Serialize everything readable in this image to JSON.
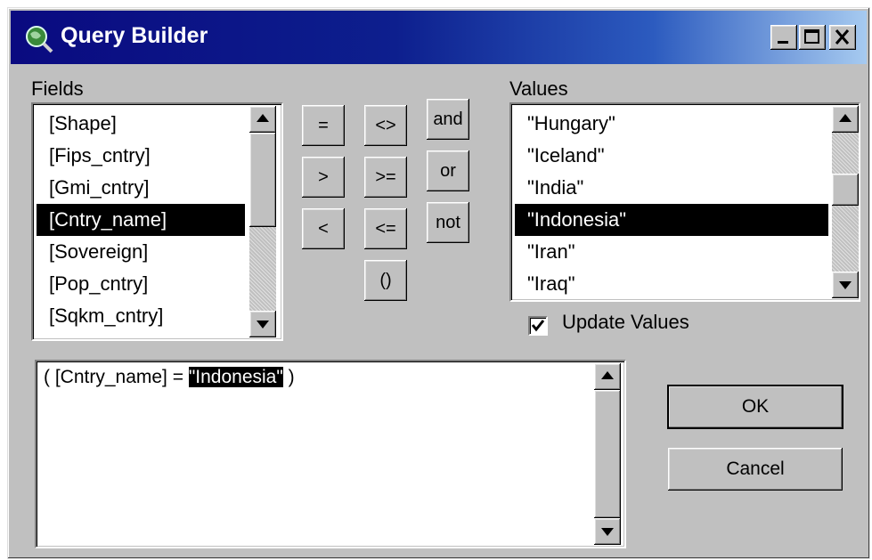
{
  "window": {
    "title": "Query Builder",
    "icon": "globe-magnifier-icon"
  },
  "fields": {
    "label": "Fields",
    "items": [
      "[Shape]",
      "[Fips_cntry]",
      "[Gmi_cntry]",
      "[Cntry_name]",
      "[Sovereign]",
      "[Pop_cntry]",
      "[Sqkm_cntry]"
    ],
    "selected": "[Cntry_name]"
  },
  "operators": [
    "=",
    "<>",
    "and",
    ">",
    ">=",
    "or",
    "<",
    "<=",
    "not",
    "()"
  ],
  "values": {
    "label": "Values",
    "items": [
      "\"Hungary\"",
      "\"Iceland\"",
      "\"India\"",
      "\"Indonesia\"",
      "\"Iran\"",
      "\"Iraq\""
    ],
    "selected": "\"Indonesia\""
  },
  "update_values": {
    "label": "Update Values",
    "checked": true
  },
  "expression": {
    "prefix": "( [Cntry_name] = ",
    "highlight": "\"Indonesia\"",
    "suffix": " )"
  },
  "buttons": {
    "ok": "OK",
    "cancel": "Cancel"
  },
  "colors": {
    "title_start": "#0a0a80",
    "title_end": "#a6caf0",
    "face": "#c0c0c0",
    "selection": "#000000"
  }
}
